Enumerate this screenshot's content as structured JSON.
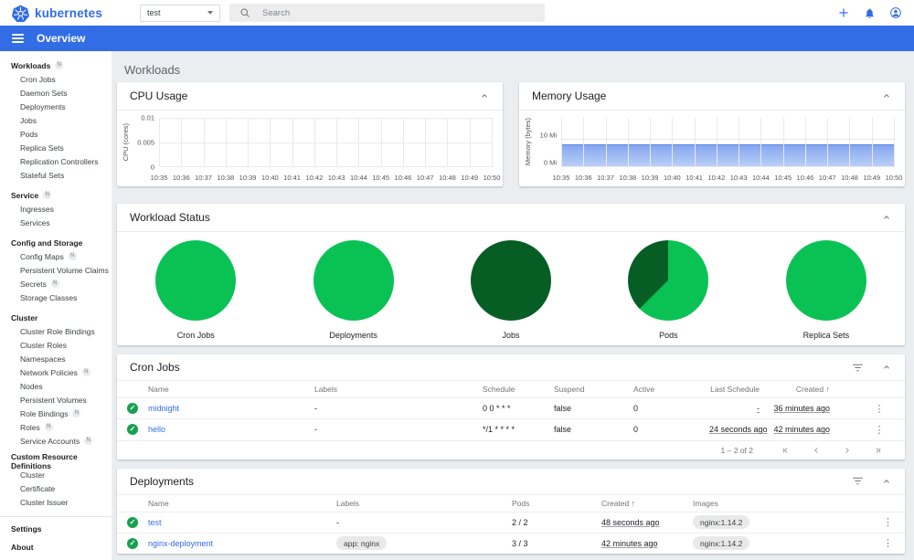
{
  "theme": {
    "accent_blue": "#326de6",
    "success_green": "#0ac254",
    "success_dark_green": "#075e25",
    "main_background": "#eaeef0"
  },
  "icons": {
    "logo": "kubernetes-logo",
    "search": "search-icon",
    "namespace_caret": "chevron-down-icon",
    "create": "plus-icon",
    "notifications": "bell-icon",
    "profile": "account-circle-icon",
    "menu": "hamburger-icon",
    "collapse": "chevron-up-icon",
    "filter": "filter-list-icon",
    "row_status": "check-circle-icon",
    "row_menu": "vertical-dots-icon",
    "sort": "arrow-up-icon",
    "pagination": [
      "first-page-icon",
      "chevron-left-icon",
      "chevron-right-icon",
      "last-page-icon"
    ]
  },
  "header": {
    "brand": "kubernetes",
    "namespace": {
      "value": "test"
    },
    "search": {
      "placeholder": "Search"
    }
  },
  "appbar": {
    "title": "Overview"
  },
  "sidebar": {
    "sections": [
      {
        "label": "Workloads",
        "badge": "N",
        "items": [
          {
            "label": "Cron Jobs"
          },
          {
            "label": "Daemon Sets"
          },
          {
            "label": "Deployments"
          },
          {
            "label": "Jobs"
          },
          {
            "label": "Pods"
          },
          {
            "label": "Replica Sets"
          },
          {
            "label": "Replication Controllers"
          },
          {
            "label": "Stateful Sets"
          }
        ]
      },
      {
        "label": "Service",
        "badge": "N",
        "items": [
          {
            "label": "Ingresses"
          },
          {
            "label": "Services"
          }
        ]
      },
      {
        "label": "Config and Storage",
        "items": [
          {
            "label": "Config Maps",
            "badge": "N"
          },
          {
            "label": "Persistent Volume Claims",
            "badge": "N"
          },
          {
            "label": "Secrets",
            "badge": "N"
          },
          {
            "label": "Storage Classes"
          }
        ]
      },
      {
        "label": "Cluster",
        "items": [
          {
            "label": "Cluster Role Bindings"
          },
          {
            "label": "Cluster Roles"
          },
          {
            "label": "Namespaces"
          },
          {
            "label": "Network Policies",
            "badge": "N"
          },
          {
            "label": "Nodes"
          },
          {
            "label": "Persistent Volumes"
          },
          {
            "label": "Role Bindings",
            "badge": "N"
          },
          {
            "label": "Roles",
            "badge": "N"
          },
          {
            "label": "Service Accounts",
            "badge": "N"
          }
        ]
      },
      {
        "label": "Custom Resource Definitions",
        "items": [
          {
            "label": "Cluster"
          },
          {
            "label": "Certificate"
          },
          {
            "label": "Cluster Issuer"
          }
        ]
      }
    ],
    "footer": [
      {
        "label": "Settings"
      },
      {
        "label": "About"
      }
    ]
  },
  "main": {
    "page_title": "Workloads"
  },
  "chart_data": [
    {
      "type": "line",
      "title": "CPU Usage",
      "xlabel": "",
      "ylabel": "CPU (cores)",
      "yticks": [
        "0.01",
        "0.005",
        "0"
      ],
      "ylim": [
        0,
        0.01
      ],
      "grid": true,
      "legend": false,
      "categories": [
        "10:35",
        "10:36",
        "10:37",
        "10:38",
        "10:39",
        "10:40",
        "10:41",
        "10:42",
        "10:43",
        "10:44",
        "10:45",
        "10:46",
        "10:47",
        "10:48",
        "10:49",
        "10:50"
      ],
      "series": []
    },
    {
      "type": "area",
      "title": "Memory Usage",
      "xlabel": "",
      "ylabel": "Memory (bytes)",
      "yticks": [
        "0 Mi",
        "10 Mi"
      ],
      "unit": "Mi",
      "ylim": [
        0,
        10
      ],
      "grid": true,
      "legend": false,
      "fill_color": "#326de6",
      "categories": [
        "10:35",
        "10:36",
        "10:37",
        "10:38",
        "10:39",
        "10:40",
        "10:41",
        "10:42",
        "10:43",
        "10:44",
        "10:45",
        "10:46",
        "10:47",
        "10:48",
        "10:49",
        "10:50"
      ],
      "series": [
        {
          "name": "Memory usage",
          "values": [
            8,
            8,
            8,
            8,
            8,
            8,
            8,
            8,
            8,
            8,
            8,
            8,
            8,
            8,
            8,
            8
          ]
        }
      ]
    },
    {
      "type": "pie",
      "title": "Workload Status",
      "pies": [
        {
          "label": "Cron Jobs",
          "slices": [
            {
              "name": "running",
              "fraction": 1.0,
              "color": "#0ac254"
            }
          ]
        },
        {
          "label": "Deployments",
          "slices": [
            {
              "name": "running",
              "fraction": 1.0,
              "color": "#0ac254"
            }
          ]
        },
        {
          "label": "Jobs",
          "slices": [
            {
              "name": "succeeded",
              "fraction": 1.0,
              "color": "#075e25"
            }
          ]
        },
        {
          "label": "Pods",
          "slices": [
            {
              "name": "running",
              "fraction": 0.625,
              "color": "#0ac254"
            },
            {
              "name": "succeeded",
              "fraction": 0.375,
              "color": "#075e25"
            }
          ]
        },
        {
          "label": "Replica Sets",
          "slices": [
            {
              "name": "running",
              "fraction": 1.0,
              "color": "#0ac254"
            }
          ]
        }
      ]
    }
  ],
  "cards": {
    "cron_jobs": {
      "title": "Cron Jobs",
      "columns": {
        "name": "Name",
        "labels": "Labels",
        "schedule": "Schedule",
        "suspend": "Suspend",
        "active": "Active",
        "last_schedule": "Last Schedule",
        "created": "Created"
      },
      "sort": {
        "column": "Created",
        "direction": "asc"
      },
      "rows": [
        {
          "name": "midnight",
          "labels": "-",
          "schedule": "0 0 * * *",
          "suspend": "false",
          "active": "0",
          "last_schedule": "-",
          "created": "36 minutes ago"
        },
        {
          "name": "hello",
          "labels": "-",
          "schedule": "*/1 * * * *",
          "suspend": "false",
          "active": "0",
          "last_schedule": "24 seconds ago",
          "created": "42 minutes ago"
        }
      ],
      "pagination": {
        "range_label": "1 – 2 of 2"
      }
    },
    "deployments": {
      "title": "Deployments",
      "columns": {
        "name": "Name",
        "labels": "Labels",
        "pods": "Pods",
        "created": "Created",
        "images": "Images"
      },
      "sort": {
        "column": "Created",
        "direction": "asc"
      },
      "rows": [
        {
          "name": "test",
          "labels": "-",
          "pods": "2 / 2",
          "created": "48 seconds ago",
          "images": "nginx:1.14.2"
        },
        {
          "name": "nginx-deployment",
          "labels": "app: nginx",
          "pods": "3 / 3",
          "created": "42 minutes ago",
          "images": "nginx:1.14.2"
        }
      ]
    }
  }
}
